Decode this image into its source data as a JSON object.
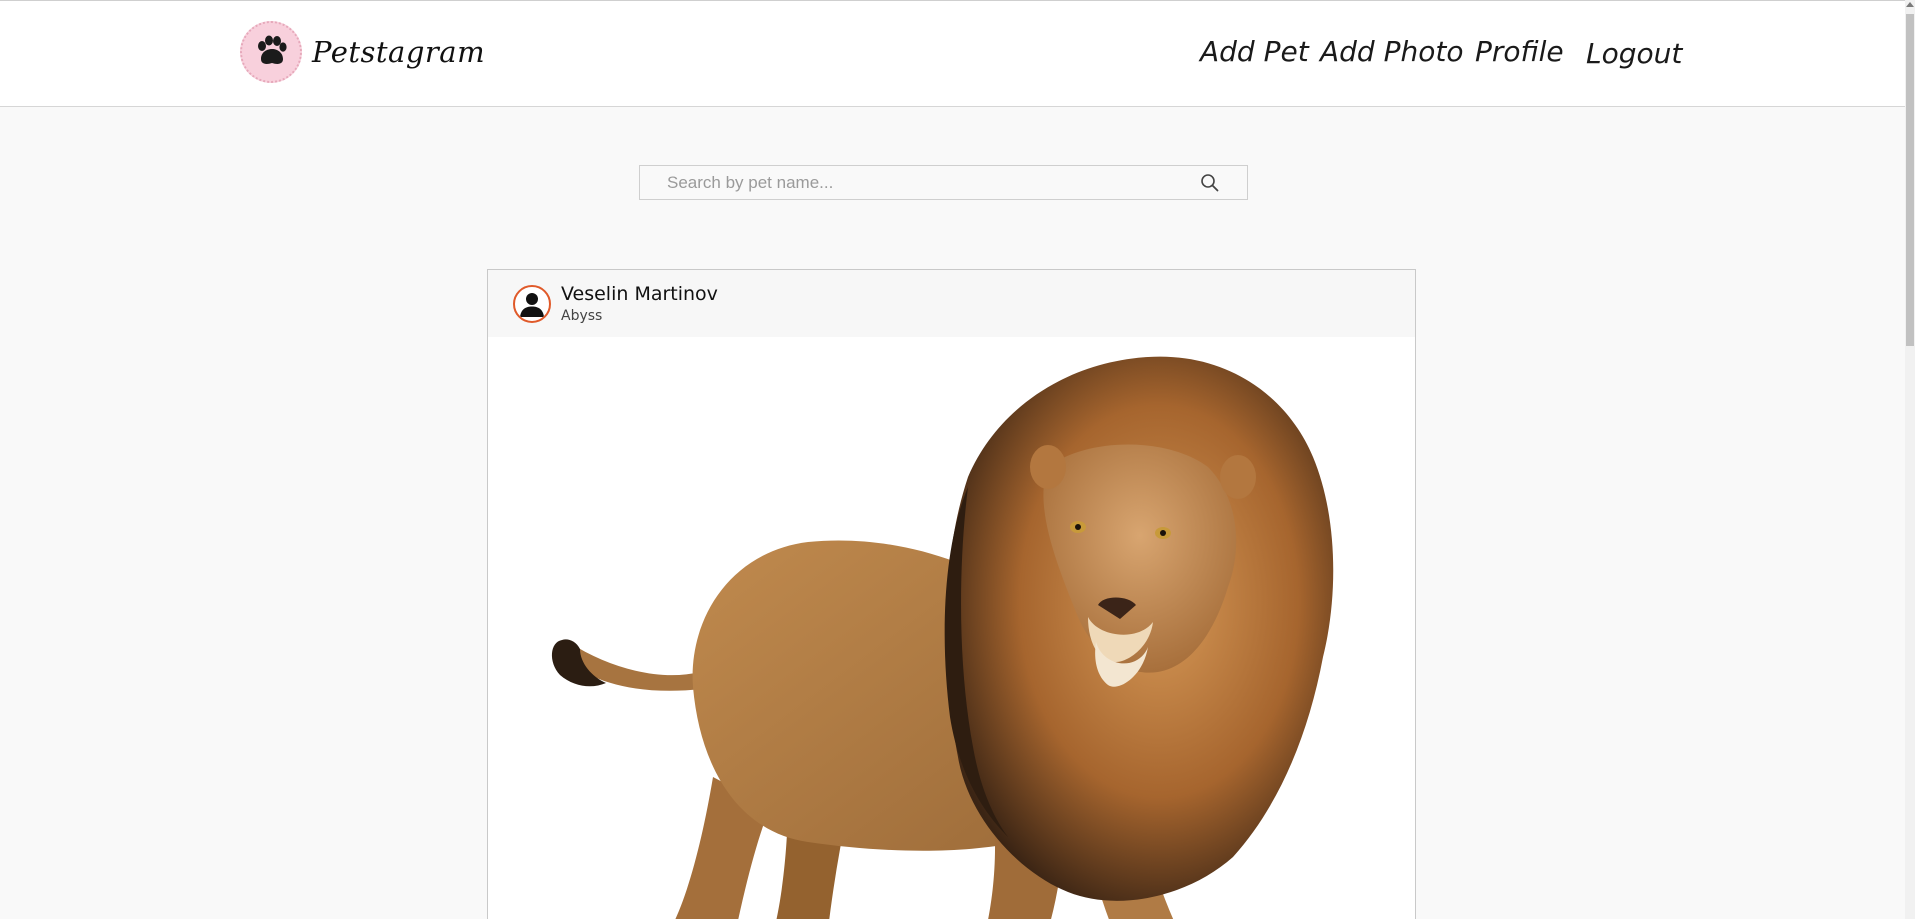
{
  "brand": {
    "name": "Petstagram",
    "logo_icon": "paw-icon",
    "logo_bg": "#f8d0dc"
  },
  "nav": {
    "items": [
      {
        "label": "Add Pet"
      },
      {
        "label": "Add Photo"
      },
      {
        "label": "Profile"
      },
      {
        "label": "Logout"
      }
    ]
  },
  "search": {
    "value": "",
    "placeholder": "Search by pet name...",
    "icon": "search-icon"
  },
  "post": {
    "owner_name": "Veselin Martinov",
    "pet_name": "Abyss",
    "avatar_icon": "user-silhouette-icon",
    "avatar_ring_color": "#e05a2a",
    "photo_subject": "lion"
  }
}
